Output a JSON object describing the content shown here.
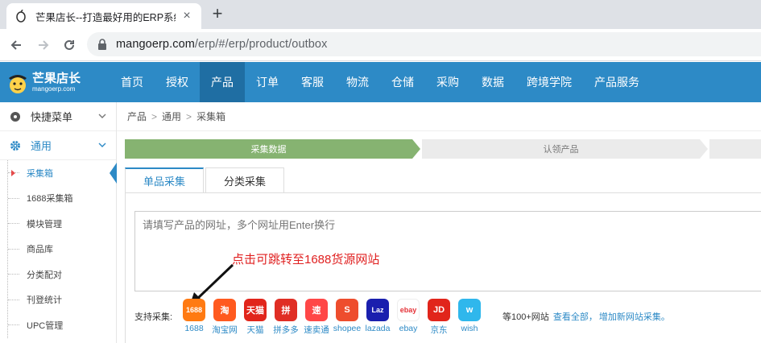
{
  "browser": {
    "tab_title": "芒果店长--打造最好用的ERP系统",
    "url_domain": "mangoerp.com",
    "url_path": "/erp/#/erp/product/outbox"
  },
  "app": {
    "brand": "芒果店长",
    "brand_sub": "mangoerp.com",
    "nav": [
      "首页",
      "授权",
      "产品",
      "订单",
      "客服",
      "物流",
      "仓储",
      "采购",
      "数据",
      "跨境学院",
      "产品服务"
    ],
    "nav_active": "产品"
  },
  "sidebar": {
    "groups": [
      {
        "label": "快捷菜单",
        "icon": "disc-icon"
      },
      {
        "label": "通用",
        "icon": "gear-icon"
      }
    ],
    "items": [
      "采集箱",
      "1688采集箱",
      "模块管理",
      "商品库",
      "分类配对",
      "刊登统计",
      "UPC管理"
    ],
    "active_item": "采集箱"
  },
  "breadcrumb": [
    "产品",
    "通用",
    "采集箱"
  ],
  "steps": [
    "采集数据",
    "认领产品"
  ],
  "content_tabs": [
    "单品采集",
    "分类采集"
  ],
  "url_input": {
    "placeholder": "请填写产品的网址，多个网址用Enter换行"
  },
  "annotation": "点击可跳转至1688货源网站",
  "sources": {
    "label": "支持采集:",
    "items": [
      {
        "name": "1688",
        "color": "#ff7a12",
        "glyph": "1688"
      },
      {
        "name": "淘宝网",
        "color": "#ff5a1f",
        "glyph": "淘"
      },
      {
        "name": "天猫",
        "color": "#e1251b",
        "glyph": "天猫"
      },
      {
        "name": "拼多多",
        "color": "#e02e24",
        "glyph": "拼"
      },
      {
        "name": "速卖通",
        "color": "#ff4747",
        "glyph": "速"
      },
      {
        "name": "shopee",
        "color": "#ee4d2d",
        "glyph": "S"
      },
      {
        "name": "lazada",
        "color": "#1a1fae",
        "glyph": "Laz"
      },
      {
        "name": "ebay",
        "color": "#ffffff",
        "glyph": "ebay"
      },
      {
        "name": "京东",
        "color": "#e1251b",
        "glyph": "JD"
      },
      {
        "name": "wish",
        "color": "#2fb7ec",
        "glyph": "w"
      }
    ],
    "more_text": "等100+网站",
    "view_all": "查看全部，",
    "add_new": "增加新网站采集。"
  }
}
